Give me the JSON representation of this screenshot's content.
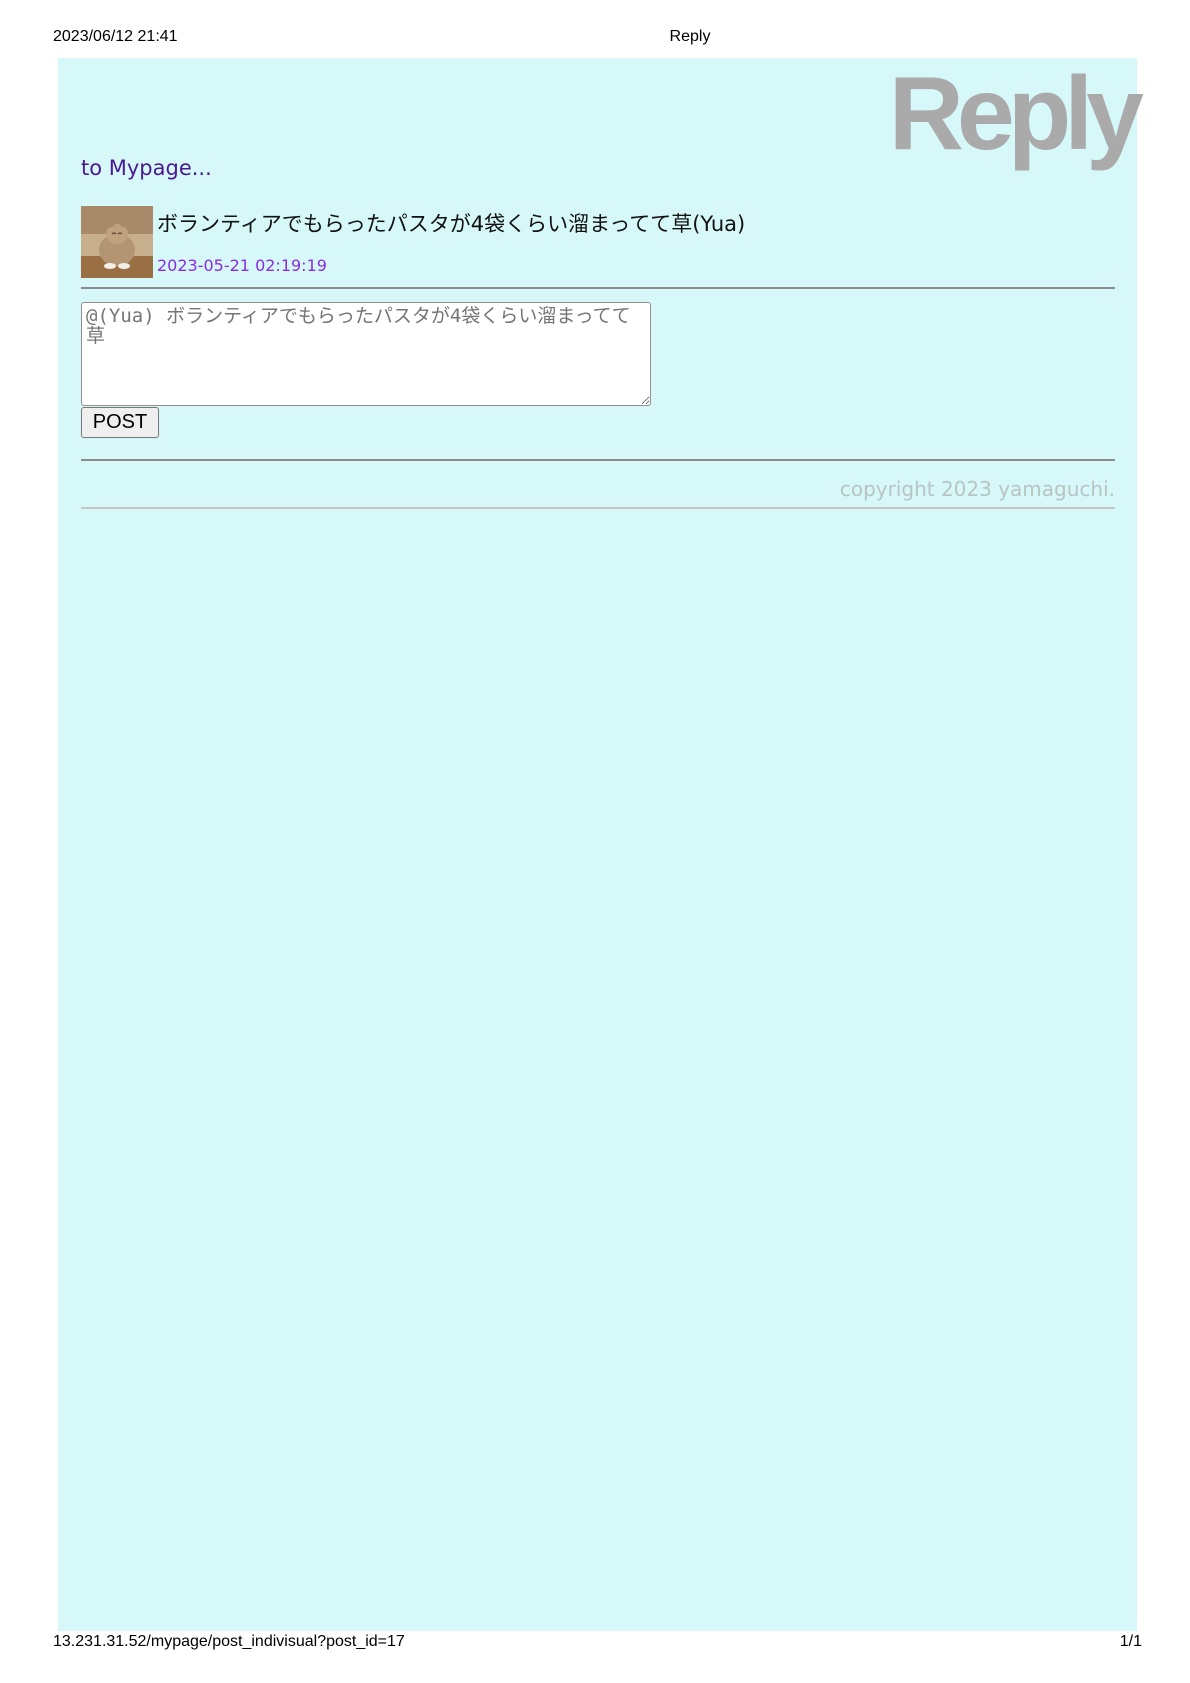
{
  "print_header": {
    "datetime": "2023/06/12 21:41",
    "title": "Reply"
  },
  "print_footer": {
    "url": "13.231.31.52/mypage/post_indivisual?post_id=17",
    "page": "1/1"
  },
  "brand": "Reply",
  "nav": {
    "back_link": "to Mypage..."
  },
  "post": {
    "avatar_icon": "cat-photo-icon",
    "text": "ボランティアでもらったパスタが4袋くらい溜まってて草(Yua)",
    "timestamp": "2023-05-21 02:19:19"
  },
  "reply_form": {
    "placeholder": "@(Yua) ボランティアでもらったパスタが4袋くらい溜まってて草",
    "value": "",
    "submit_label": "POST"
  },
  "footer": {
    "copyright": "copyright 2023 yamaguchi."
  },
  "colors": {
    "page_background": "#d6f8f8",
    "brand": "#aaaaaa",
    "link": "#4b1894",
    "timestamp": "#8a2be2",
    "copyright": "#b8c4c4"
  }
}
